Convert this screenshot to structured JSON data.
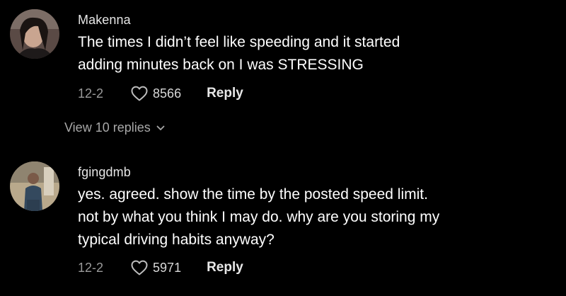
{
  "comments": [
    {
      "username": "Makenna",
      "text_lines": [
        "The times I didn’t feel like speeding and it started",
        "adding minutes back on I was STRESSING"
      ],
      "date": "12-2",
      "likes": "8566",
      "reply_label": "Reply",
      "view_replies_label": "View 10 replies",
      "icons": {
        "like": "heart-outline-icon",
        "expand": "chevron-down-icon"
      }
    },
    {
      "username": "fgingdmb",
      "text_lines": [
        "yes. agreed. show the time by the posted speed limit.",
        "not by what you think I may do. why are you storing my",
        "typical driving habits anyway?"
      ],
      "date": "12-2",
      "likes": "5971",
      "reply_label": "Reply",
      "icons": {
        "like": "heart-outline-icon"
      }
    }
  ],
  "colors": {
    "background": "#000000",
    "primary_text": "#ffffff",
    "secondary_text": "#9a9a9a"
  }
}
